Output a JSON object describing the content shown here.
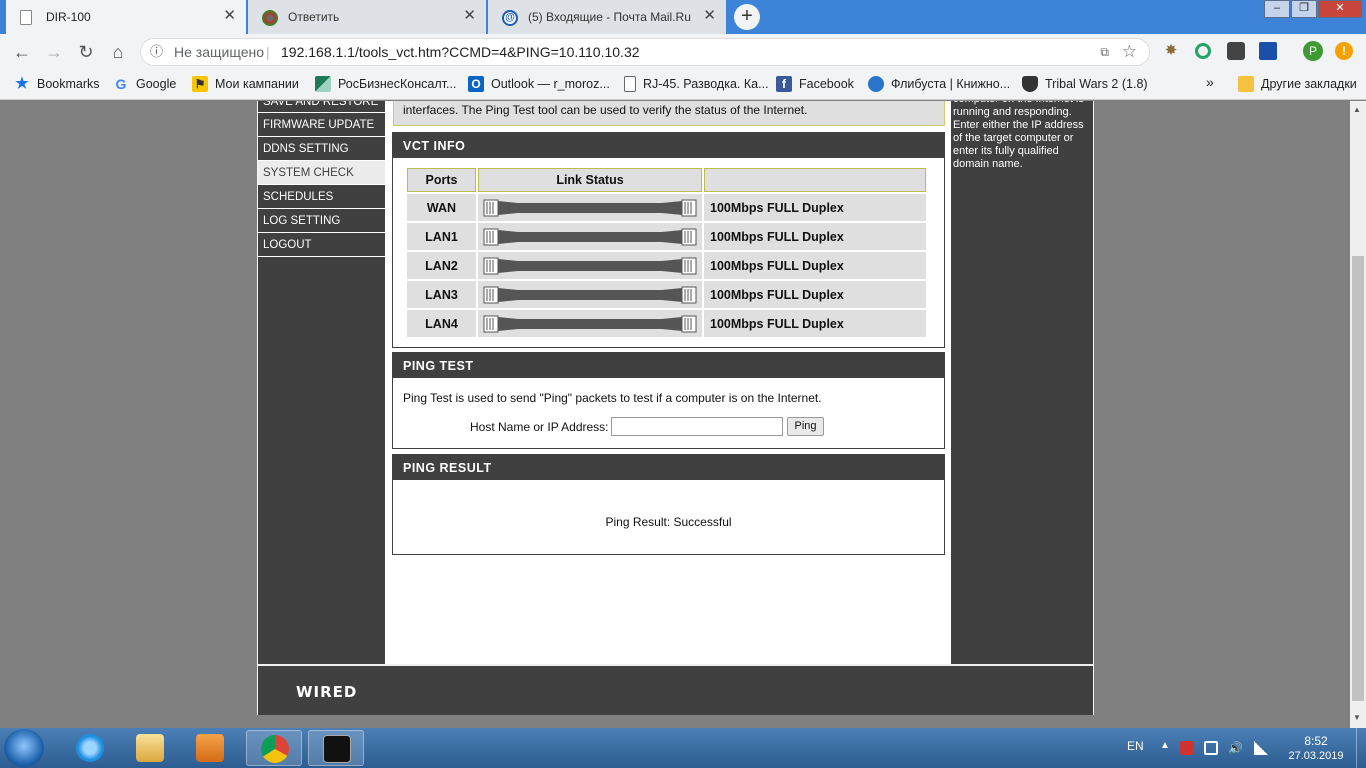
{
  "browser": {
    "tabs": [
      {
        "title": "DIR-100",
        "active": true
      },
      {
        "title": "Ответить",
        "active": false
      },
      {
        "title": "(5) Входящие - Почта Mail.Ru",
        "active": false
      }
    ],
    "new_tab": "+",
    "security_label": "Не защищено",
    "url": "192.168.1.1/tools_vct.htm?CCMD=4&PING=10.110.10.32",
    "profile_initial": "P"
  },
  "bookmarks": [
    {
      "label": "Bookmarks",
      "icon": "star-icon"
    },
    {
      "label": "Google",
      "icon": "google-icon"
    },
    {
      "label": "Мои кампании",
      "icon": "campaign-icon"
    },
    {
      "label": "РосБизнесКонсалт...",
      "icon": "rbc-icon"
    },
    {
      "label": "Outlook — r_moroz...",
      "icon": "outlook-icon"
    },
    {
      "label": "RJ-45. Разводка. Ка...",
      "icon": "page-icon"
    },
    {
      "label": "Facebook",
      "icon": "facebook-icon"
    },
    {
      "label": "Флибуста | Книжно...",
      "icon": "flibusta-icon"
    },
    {
      "label": "Tribal Wars 2 (1.8)",
      "icon": "shield-icon"
    }
  ],
  "bookmarks_overflow": "»",
  "other_bookmarks": "Другие закладки",
  "router": {
    "nav": [
      {
        "label": "SAVE AND RESTORE",
        "active": false
      },
      {
        "label": "FIRMWARE UPDATE",
        "active": false
      },
      {
        "label": "DDNS SETTING",
        "active": false
      },
      {
        "label": "SYSTEM CHECK",
        "active": true
      },
      {
        "label": "SCHEDULES",
        "active": false
      },
      {
        "label": "LOG SETTING",
        "active": false
      },
      {
        "label": "LOGOUT",
        "active": false
      }
    ],
    "intro_text": "interfaces. The Ping Test tool can be used to verify the status of the Internet.",
    "vct": {
      "title": "VCT INFO",
      "headers": [
        "Ports",
        "Link Status",
        ""
      ],
      "rows": [
        {
          "port": "WAN",
          "status": "100Mbps FULL Duplex"
        },
        {
          "port": "LAN1",
          "status": "100Mbps FULL Duplex"
        },
        {
          "port": "LAN2",
          "status": "100Mbps FULL Duplex"
        },
        {
          "port": "LAN3",
          "status": "100Mbps FULL Duplex"
        },
        {
          "port": "LAN4",
          "status": "100Mbps FULL Duplex"
        }
      ]
    },
    "ping_test": {
      "title": "PING TEST",
      "description": "Ping Test is used to send \"Ping\" packets to test if a computer is on the Internet.",
      "host_label": "Host Name or IP Address:",
      "host_value": "",
      "button": "Ping"
    },
    "ping_result": {
      "title": "PING RESULT",
      "text": "Ping Result: Successful"
    },
    "help_text": "computer on the Internet is running and responding. Enter either the IP address of the target computer or enter its fully qualified domain name.",
    "footer_logo": "WIRED"
  },
  "taskbar": {
    "lang": "EN",
    "time": "8:52",
    "date": "27.03.2019"
  },
  "colors": {
    "router_dark": "#404040",
    "router_row": "#dfdfdf",
    "header_border": "#b4c04a",
    "tabbar": "#3d83d8"
  }
}
